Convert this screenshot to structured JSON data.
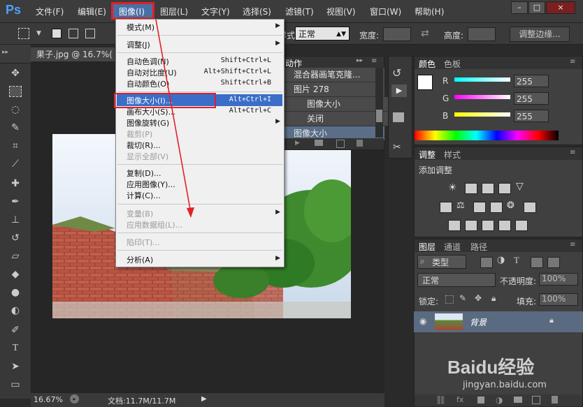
{
  "app": {
    "logo": "Ps"
  },
  "menubar": {
    "items": [
      "文件(F)",
      "编辑(E)",
      "图像(I)",
      "图层(L)",
      "文字(Y)",
      "选择(S)",
      "滤镜(T)",
      "视图(V)",
      "窗口(W)",
      "帮助(H)"
    ],
    "window_buttons": [
      "–",
      "□",
      "×"
    ]
  },
  "options_bar": {
    "mode_label": "样式:",
    "mode_value": "正常",
    "width_label": "宽度:",
    "height_label": "高度:",
    "refine_button": "调整边缘..."
  },
  "document": {
    "tab_title": "果子.jpg @ 16.7%(",
    "status_zoom": "16.67%",
    "status_doc": "文档:11.7M/11.7M"
  },
  "image_menu": {
    "items": [
      {
        "label": "模式(M)",
        "shortcut": "",
        "disabled": false,
        "submenu": true
      },
      {
        "label": "调整(J)",
        "shortcut": "",
        "disabled": false,
        "submenu": true
      },
      {
        "label": "自动色调(N)",
        "shortcut": "Shift+Ctrl+L",
        "disabled": false,
        "submenu": false
      },
      {
        "label": "自动对比度(U)",
        "shortcut": "Alt+Shift+Ctrl+L",
        "disabled": false,
        "submenu": false
      },
      {
        "label": "自动颜色(O)",
        "shortcut": "Shift+Ctrl+B",
        "disabled": false,
        "submenu": false
      },
      {
        "label": "图像大小(I)...",
        "shortcut": "Alt+Ctrl+I",
        "disabled": false,
        "submenu": false
      },
      {
        "label": "画布大小(S)...",
        "shortcut": "Alt+Ctrl+C",
        "disabled": false,
        "submenu": false
      },
      {
        "label": "图像旋转(G)",
        "shortcut": "",
        "disabled": false,
        "submenu": true
      },
      {
        "label": "裁剪(P)",
        "shortcut": "",
        "disabled": true,
        "submenu": false
      },
      {
        "label": "裁切(R)...",
        "shortcut": "",
        "disabled": false,
        "submenu": false
      },
      {
        "label": "显示全部(V)",
        "shortcut": "",
        "disabled": true,
        "submenu": false
      },
      {
        "label": "复制(D)...",
        "shortcut": "",
        "disabled": false,
        "submenu": false
      },
      {
        "label": "应用图像(Y)...",
        "shortcut": "",
        "disabled": false,
        "submenu": false
      },
      {
        "label": "计算(C)...",
        "shortcut": "",
        "disabled": false,
        "submenu": false
      },
      {
        "label": "变量(B)",
        "shortcut": "",
        "disabled": true,
        "submenu": true
      },
      {
        "label": "应用数据组(L)...",
        "shortcut": "",
        "disabled": true,
        "submenu": false
      },
      {
        "label": "陷印(T)...",
        "shortcut": "",
        "disabled": true,
        "submenu": false
      },
      {
        "label": "分析(A)",
        "shortcut": "",
        "disabled": false,
        "submenu": true
      }
    ],
    "highlighted_index": 5
  },
  "actions_panel": {
    "tab": "动作",
    "rows": [
      "混合器画笔克隆...",
      "图片 278",
      "图像大小",
      "关闭",
      "图像大小"
    ]
  },
  "color_panel": {
    "tabs": [
      "颜色",
      "色板"
    ],
    "channels": [
      {
        "label": "R",
        "value": "255"
      },
      {
        "label": "G",
        "value": "255"
      },
      {
        "label": "B",
        "value": "255"
      }
    ]
  },
  "adjust_panel": {
    "tabs": [
      "调整",
      "样式"
    ],
    "title": "添加调整"
  },
  "layers_panel": {
    "tabs": [
      "图层",
      "通道",
      "路径"
    ],
    "filter_label": "类型",
    "blend_mode": "正常",
    "opacity_label": "不透明度:",
    "opacity_value": "100%",
    "lock_label": "锁定:",
    "fill_label": "填充:",
    "fill_value": "100%",
    "layer_name": "背景"
  },
  "watermark": {
    "text": "Baidu经验",
    "url": "jingyan.baidu.com"
  },
  "colors": {
    "accent": "#3a6ec8",
    "highlight_red": "#e0202a"
  }
}
